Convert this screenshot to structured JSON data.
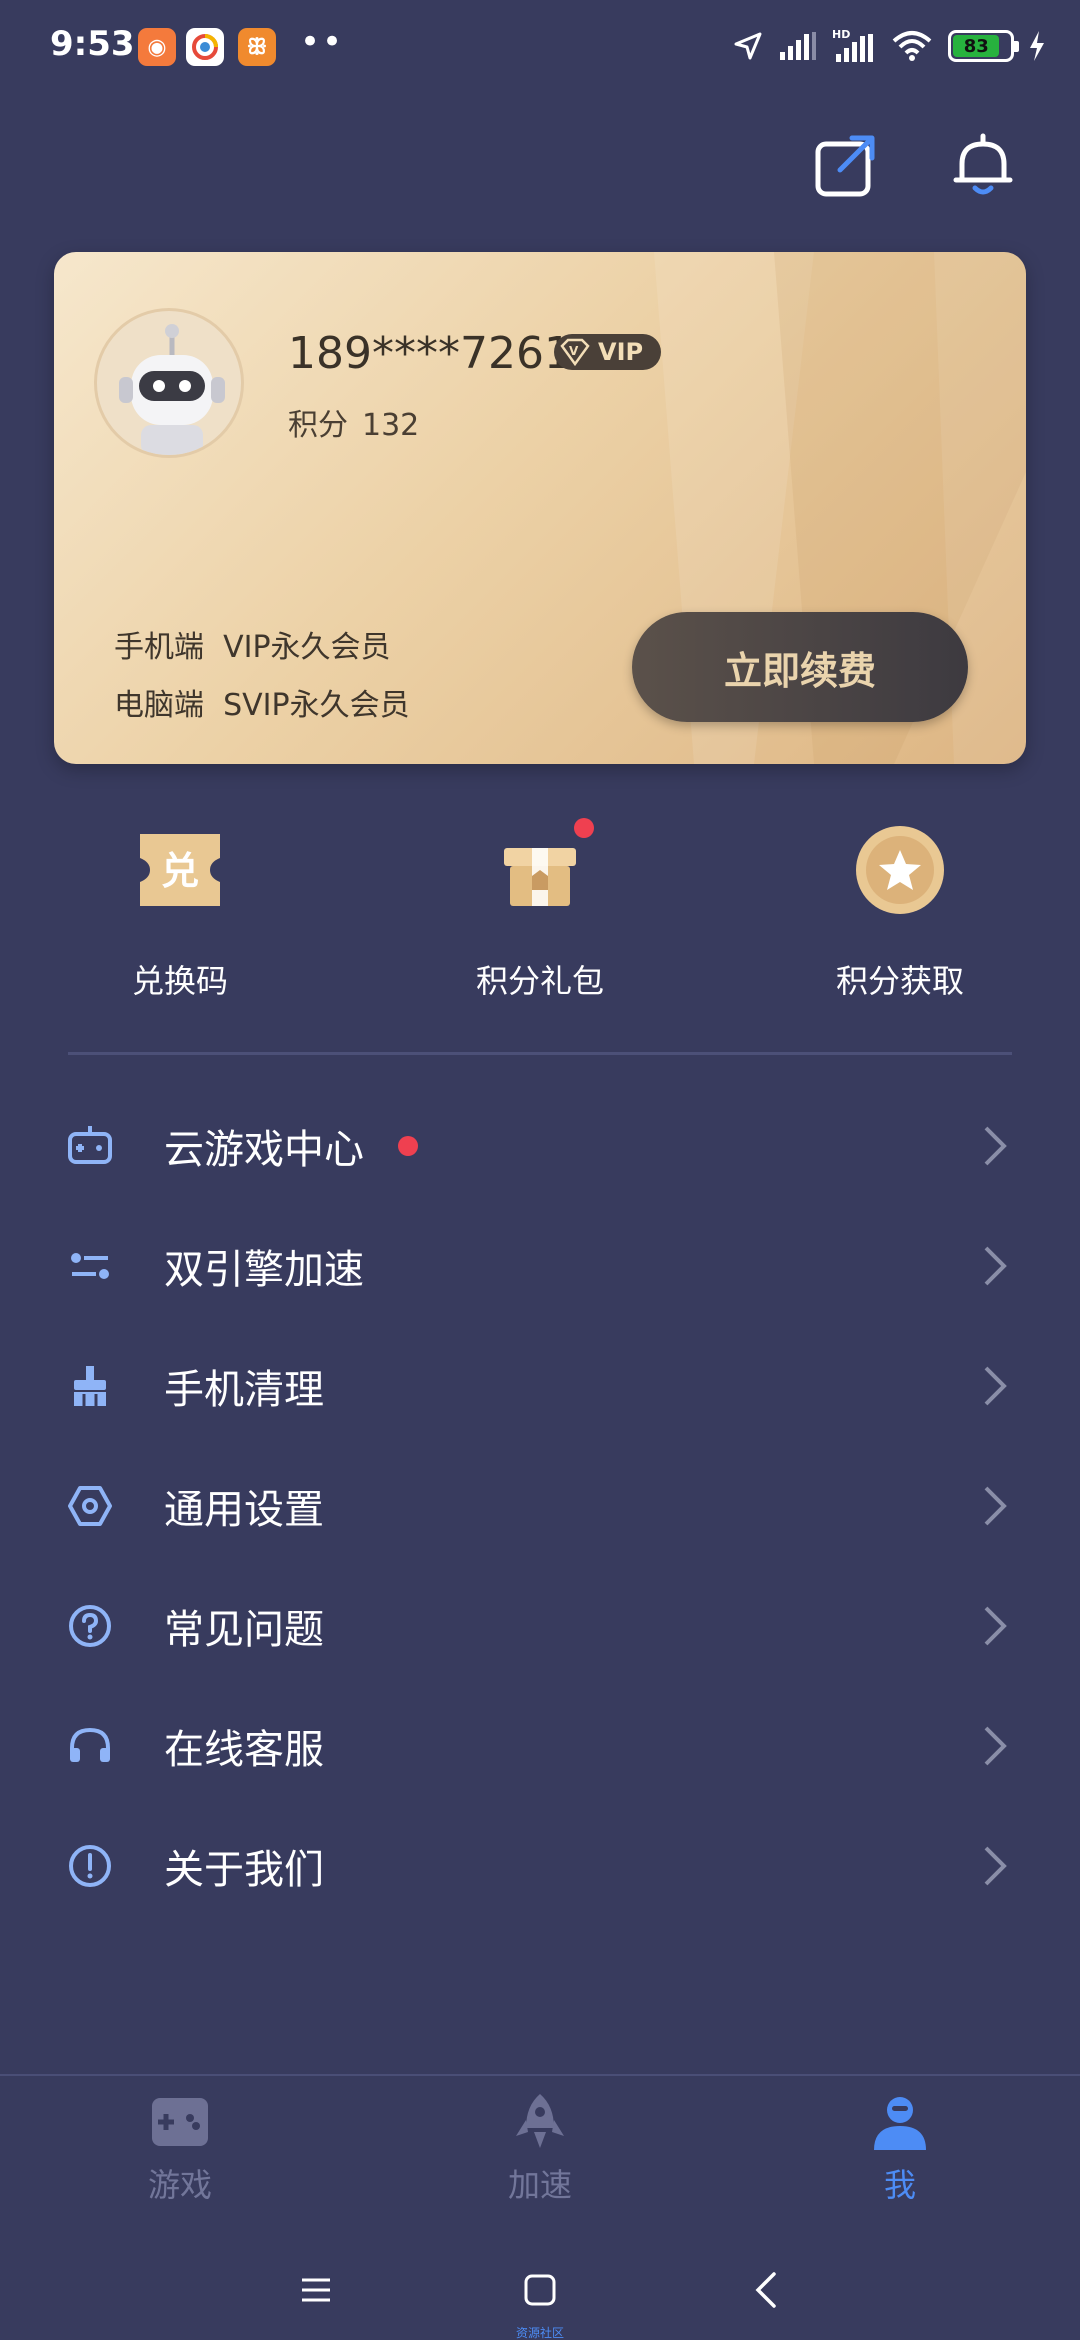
{
  "status_bar": {
    "time": "9:53",
    "battery": "83",
    "signal_label": "HD"
  },
  "top_actions": {
    "share_icon": "share-external-icon",
    "bell_icon": "bell-icon"
  },
  "card": {
    "phone": "189****7261",
    "vip_badge": "VIP",
    "vip_badge_prefix": "V",
    "points_label": "积分",
    "points_value": "132",
    "mobile_line": "手机端  VIP永久会员",
    "pc_line": "电脑端  SVIP永久会员",
    "renew_button": "立即续费"
  },
  "quick_actions": [
    {
      "label": "兑换码",
      "icon": "redeem-ticket-icon"
    },
    {
      "label": "积分礼包",
      "icon": "gift-box-icon"
    },
    {
      "label": "积分获取",
      "icon": "star-coin-icon"
    }
  ],
  "redeem_char": "兑",
  "menu": [
    {
      "label": "云游戏中心",
      "icon": "gamepad-icon"
    },
    {
      "label": "双引擎加速",
      "icon": "dual-engine-icon"
    },
    {
      "label": "手机清理",
      "icon": "broom-icon"
    },
    {
      "label": "通用设置",
      "icon": "hexagon-settings-icon"
    },
    {
      "label": "常见问题",
      "icon": "question-icon"
    },
    {
      "label": "在线客服",
      "icon": "headset-icon"
    },
    {
      "label": "关于我们",
      "icon": "info-icon"
    }
  ],
  "bottom_nav": {
    "games": "游戏",
    "boost": "加速",
    "me": "我"
  },
  "watermark": "资源社区",
  "colors": {
    "background": "#383b5e",
    "accent_blue": "#4d8cf5",
    "gold": "#e8cfa4",
    "red_dot": "#ef4050"
  }
}
